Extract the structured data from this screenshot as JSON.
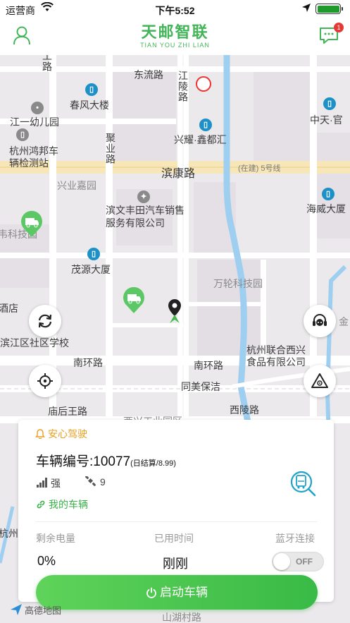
{
  "status_bar": {
    "carrier": "运营商",
    "time": "下午5:52",
    "wifi_icon": "wifi-icon",
    "location_icon": "location-arrow-icon",
    "battery_icon": "battery-icon"
  },
  "header": {
    "logo_cn": "天邮智联",
    "logo_en": "TIAN YOU ZHI LIAN",
    "message_badge": "1",
    "accent": "#43b559"
  },
  "map": {
    "labels": {
      "gong_lu": "工路",
      "dongliu": "东流路",
      "jiangling": "江陵路",
      "chunfeng": "春风大楼",
      "jiangyi": "江一幼儿园",
      "zhongtian": "中天·官",
      "hongbang": "杭州鸿邦车辆检测站",
      "xingyao": "兴耀·鑫都汇",
      "juye": "聚业路",
      "binkang": "滨康路",
      "line5": "(在建) 5号线",
      "xingye": "兴业嘉园",
      "binwen": "滨文丰田汽车销售服务有限公司",
      "haiwei": "海威大厦",
      "weike": "韦科技园",
      "maoyuan": "茂源大厦",
      "wanlun": "万轮科技园",
      "jiudian": "酒店",
      "jin": "金",
      "shequ": "滨江区社区学校",
      "nanhuan1": "南环路",
      "nanhuan2": "南环路",
      "lianhe": "杭州联合西兴食品有限公司",
      "tongmei": "同美保洁",
      "miaohou": "庙后王路",
      "xiling": "西陵路",
      "xingxing": "西兴工业园区",
      "hangzhou": "杭州",
      "shanhu": "山湖村路"
    }
  },
  "vehicle_card": {
    "safe_label": "安心驾驶",
    "vehicle_no": "车辆编号:10077",
    "pricing": "(日结算/8.99)",
    "signal": "强",
    "satellites": "9",
    "my_vehicle": "我的车辆",
    "battery_label": "剩余电量",
    "battery_value": "0%",
    "time_label": "已用时间",
    "time_value": "刚刚",
    "bt_label": "蓝牙连接",
    "bt_state": "OFF"
  },
  "start_button": {
    "label": "启动车辆"
  },
  "amap_logo": "高德地图"
}
